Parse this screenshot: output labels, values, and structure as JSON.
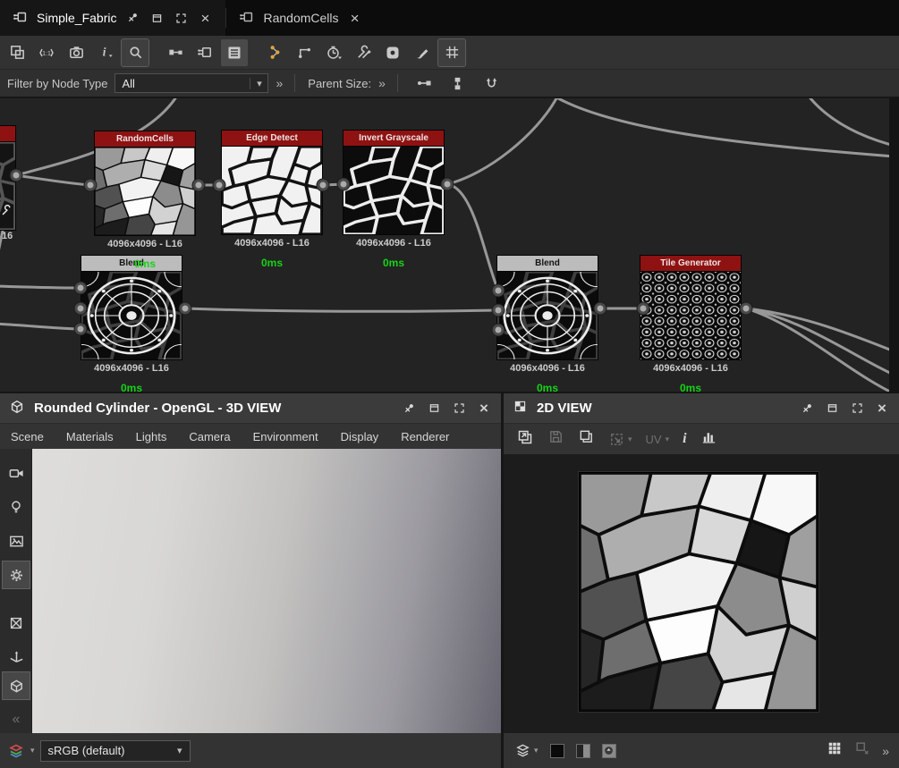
{
  "window": {
    "tabs": [
      {
        "label": "Simple_Fabric",
        "active": true
      },
      {
        "label": "RandomCells",
        "active": false
      }
    ]
  },
  "toolbar": {
    "icons": [
      "frame-select",
      "zoom-actual",
      "camera",
      "info-dropdown",
      "search",
      "link-create",
      "graph-node",
      "dock-panel",
      "pin-dots",
      "elbow-connector",
      "play-timer",
      "tools",
      "focus-region",
      "paint-brush",
      "grid-snap"
    ]
  },
  "filter_bar": {
    "label": "Filter by Node Type",
    "type_value": "All",
    "overflow": "»",
    "parent_size_label": "Parent Size:",
    "parent_size_overflow": "»",
    "icons": [
      "connector",
      "align-nodes",
      "snap-anchor"
    ]
  },
  "graph": {
    "nodes": [
      {
        "title": "RandomCells",
        "header": "red",
        "size": "4096x4096 - L16",
        "time": "0ms"
      },
      {
        "title": "Edge Detect",
        "header": "red",
        "size": "4096x4096 - L16",
        "time": "0ms"
      },
      {
        "title": "Invert Grayscale",
        "header": "red",
        "size": "4096x4096 - L16",
        "time": "0ms"
      },
      {
        "title": "Blend",
        "header": "gray",
        "size": "4096x4096 - L16",
        "time": "0ms"
      },
      {
        "title": "Blend",
        "header": "gray",
        "size": "4096x4096 - L16",
        "time": "0ms"
      },
      {
        "title": "Tile Generator",
        "header": "red",
        "size": "4096x4096 - L16",
        "time": "0ms"
      }
    ],
    "partial_node": {
      "size_visible": "16"
    },
    "time_color": "#15d415",
    "header_red": "#8e1212",
    "header_gray": "#bcbcbc"
  },
  "view3d": {
    "title": "Rounded Cylinder - OpenGL - 3D VIEW",
    "menu": [
      "Scene",
      "Materials",
      "Lights",
      "Camera",
      "Environment",
      "Display",
      "Renderer"
    ],
    "colorspace_value": "sRGB (default)",
    "sidebar_icons": [
      "video-camera",
      "light-bulb",
      "environment-image",
      "gear",
      "bounds-box",
      "gizmo-axes",
      "cube"
    ]
  },
  "view2d": {
    "title": "2D VIEW",
    "toolbar": {
      "uv_label": "UV",
      "info_glyph": "i"
    },
    "bottom_icons": [
      "layers",
      "background-black",
      "background-split",
      "mip-arrow",
      "tile-grid",
      "pixel-snap"
    ]
  },
  "glyphs": {
    "close": "×",
    "chevron_down": "▾",
    "chevrons_right": "»",
    "chevrons_left": "«",
    "one_to_one": "1:1",
    "info": "i"
  }
}
